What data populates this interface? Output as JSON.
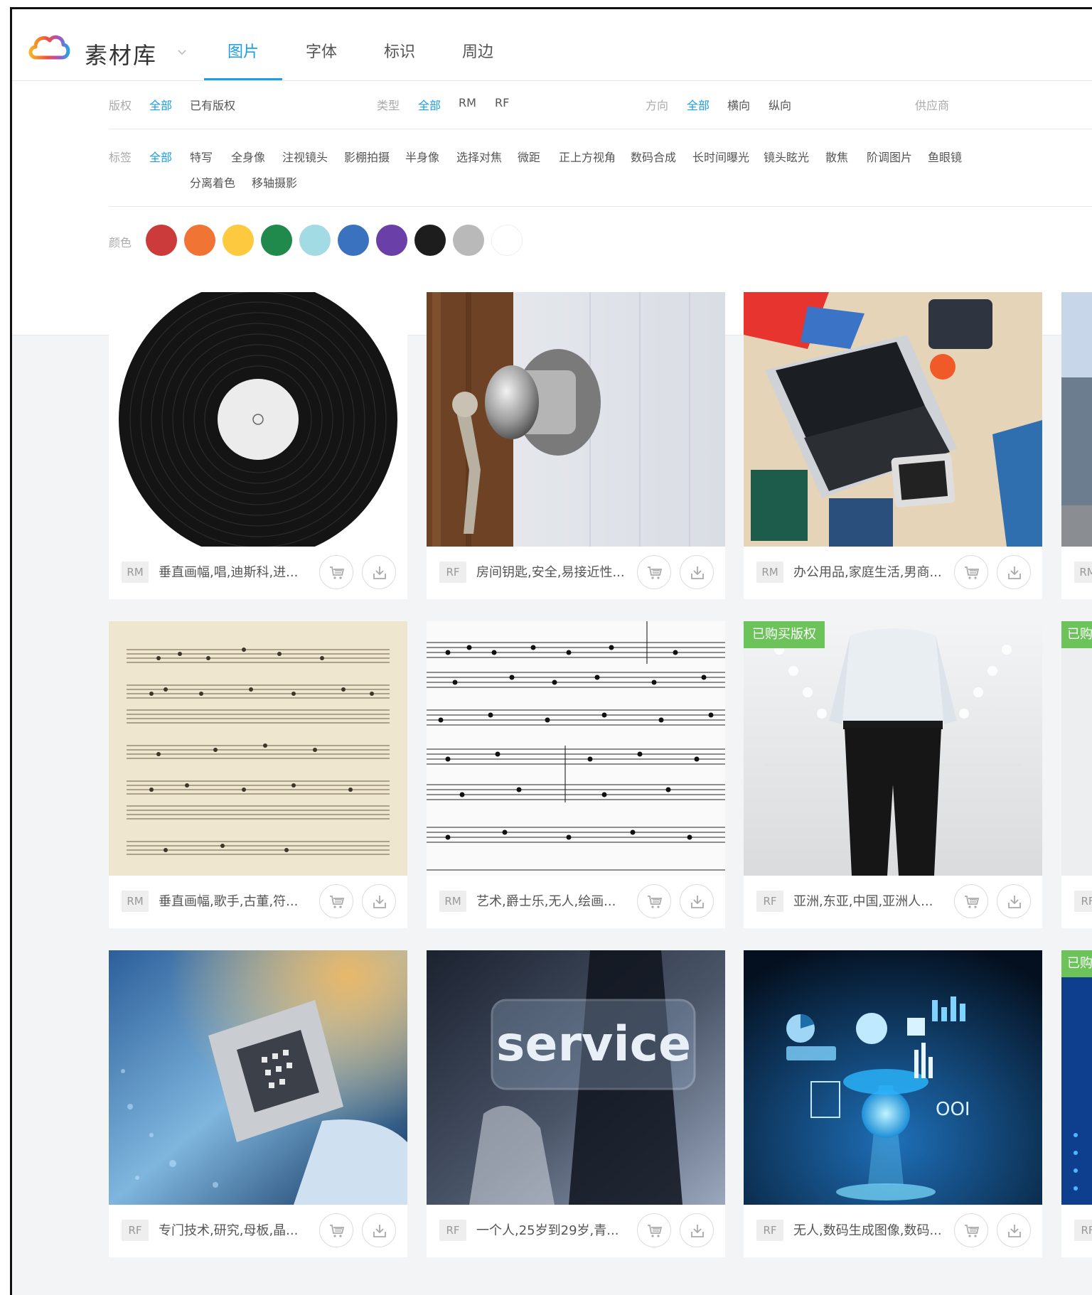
{
  "header": {
    "brand": "素材库",
    "tabs": [
      {
        "label": "图片",
        "active": true
      },
      {
        "label": "字体",
        "active": false
      },
      {
        "label": "标识",
        "active": false
      },
      {
        "label": "周边",
        "active": false
      }
    ]
  },
  "filters": {
    "copyright": {
      "label": "版权",
      "options": [
        "全部",
        "已有版权"
      ]
    },
    "type": {
      "label": "类型",
      "options": [
        "全部",
        "RM",
        "RF"
      ]
    },
    "orientation": {
      "label": "方向",
      "options": [
        "全部",
        "横向",
        "纵向"
      ]
    },
    "supplier": {
      "label": "供应商"
    },
    "tags": {
      "label": "标签",
      "options": [
        "全部",
        "特写",
        "全身像",
        "注视镜头",
        "影棚拍摄",
        "半身像",
        "选择对焦",
        "微距",
        "正上方视角",
        "数码合成",
        "长时间曝光",
        "镜头眩光",
        "散焦",
        "阶调图片",
        "鱼眼镜"
      ],
      "options_row2": [
        "分离着色",
        "移轴摄影"
      ]
    },
    "color": {
      "label": "颜色",
      "swatches": [
        "#cc3b3b",
        "#f07433",
        "#fcc93f",
        "#1f8a4c",
        "#a2dbe3",
        "#3b72c0",
        "#6b3fa8",
        "#1d1d1d",
        "#b9b9b9",
        "#ffffff"
      ]
    }
  },
  "cards": [
    {
      "license": "RM",
      "title": "垂直画幅,唱,迪斯科,进...",
      "bought": ""
    },
    {
      "license": "RF",
      "title": "房间钥匙,安全,易接近性...",
      "bought": ""
    },
    {
      "license": "RM",
      "title": "办公用品,家庭生活,男商...",
      "bought": ""
    },
    {
      "license": "RM",
      "title": "垂直画幅,歌手,古董,符...",
      "bought": ""
    },
    {
      "license": "RM",
      "title": "艺术,爵士乐,无人,绘画...",
      "bought": ""
    },
    {
      "license": "RF",
      "title": "亚洲,东亚,中国,亚洲人...",
      "bought": "已购买版权"
    },
    {
      "license": "RF",
      "title": "专门技术,研究,母板,晶...",
      "bought": ""
    },
    {
      "license": "RF",
      "title": "一个人,25岁到29岁,青...",
      "bought": ""
    },
    {
      "license": "RF",
      "title": "无人,数码生成图像,数码...",
      "bought": ""
    }
  ],
  "partial_cards": [
    {
      "license": "RM",
      "bought": ""
    },
    {
      "license": "RF",
      "bought": "已购"
    },
    {
      "license": "RF",
      "bought": "已购"
    }
  ],
  "image_texts": {
    "service": "service",
    "ooi": "OOI"
  }
}
